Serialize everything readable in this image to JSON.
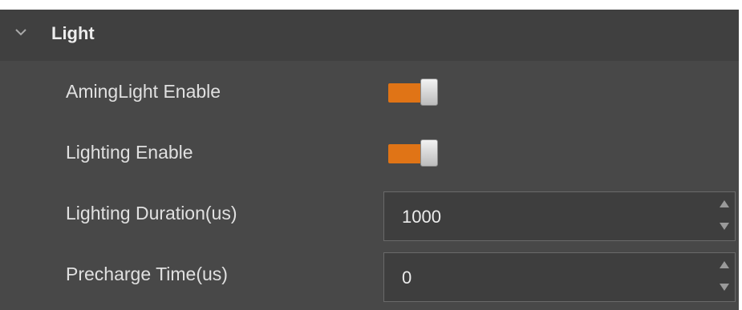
{
  "section": {
    "title": "Light",
    "expanded": true,
    "icon": "chevron-down-icon"
  },
  "rows": [
    {
      "label": "AmingLight Enable",
      "type": "toggle",
      "value": "on"
    },
    {
      "label": "Lighting Enable",
      "type": "toggle",
      "value": "on"
    },
    {
      "label": "Lighting Duration(us)",
      "type": "number",
      "value": "1000"
    },
    {
      "label": "Precharge Time(us)",
      "type": "number",
      "value": "0"
    }
  ],
  "colors": {
    "panel_bg": "#484848",
    "header_bg": "#404040",
    "toggle_on": "#e07416",
    "input_bg": "#3e3e3e",
    "text": "#e0e0e0"
  }
}
